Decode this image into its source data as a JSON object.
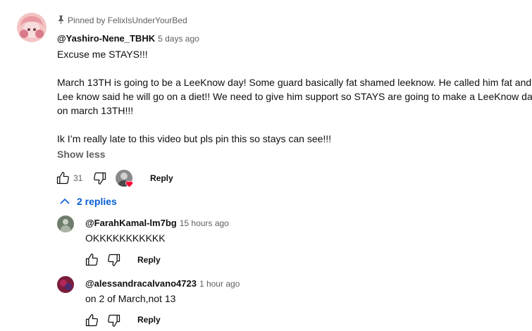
{
  "comment": {
    "pinned_label": "Pinned by FelixIsUnderYourBed",
    "author": "@Yashiro-Nene_TBHK",
    "time": "5 days ago",
    "lines": [
      "Excuse me STAYS!!!",
      "March 13TH is going to be a LeeKnow day! Some guard basically fat shamed leeknow. He called him fat and",
      "Lee know said he will go on a diet!! We need to give him support so STAYS are going to make a LeeKnow day",
      "on march 13TH!!!",
      "Ik I’m really late to this video but pls pin this so stays can see!!!"
    ],
    "show_less": "Show less",
    "like_count": "31",
    "reply_label": "Reply"
  },
  "replies_toggle": "2 replies",
  "replies": [
    {
      "author": "@FarahKamal-lm7bg",
      "time": "15 hours ago",
      "text": "OKKKKKKKKKKK",
      "reply_label": "Reply"
    },
    {
      "author": "@alessandracalvano4723",
      "time": "1 hour ago",
      "text": "on 2 of March,not 13",
      "reply_label": "Reply"
    }
  ],
  "colors": {
    "link_blue": "#065fd4",
    "secondary_text": "#606060",
    "heart_red": "#ff0033"
  }
}
